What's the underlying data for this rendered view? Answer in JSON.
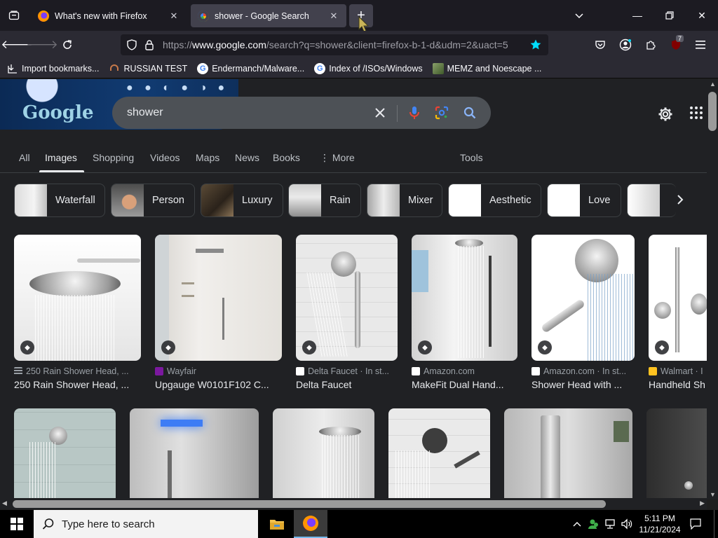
{
  "browser": {
    "tabs": [
      {
        "title": "What's new with Firefox",
        "active": false
      },
      {
        "title": "shower - Google Search",
        "active": true
      }
    ],
    "new_tab": "+",
    "url_prefix": "https://",
    "url_host": "www.google.com",
    "url_path": "/search?q=shower&client=firefox-b-1-d&udm=2&uact=5",
    "extension_badge": "7",
    "bookmarks": [
      {
        "label": "Import bookmarks...",
        "icon": "import-icon"
      },
      {
        "label": "RUSSIAN TEST",
        "icon": "headphones-icon"
      },
      {
        "label": "Endermanch/Malware...",
        "icon": "google-icon"
      },
      {
        "label": "Index of /ISOs/Windows",
        "icon": "google-icon"
      },
      {
        "label": "MEMZ and Noescape ...",
        "icon": "image-icon"
      }
    ]
  },
  "google": {
    "logo": "Google",
    "query": "shower",
    "filters": [
      "All",
      "Images",
      "Shopping",
      "Videos",
      "Maps",
      "News",
      "Books",
      "More",
      "Tools"
    ],
    "active_filter": "Images",
    "chips": [
      "Waterfall",
      "Person",
      "Luxury",
      "Rain",
      "Mixer",
      "Aesthetic",
      "Love"
    ],
    "results": [
      {
        "source": "250 Rain Shower Head, ...",
        "caption": "250 Rain Shower Head, ..."
      },
      {
        "source": "Wayfair",
        "caption": "Upgauge W0101F102 C..."
      },
      {
        "source": "Delta Faucet · In st...",
        "caption": "Delta Faucet"
      },
      {
        "source": "Amazon.com",
        "caption": "MakeFit Dual Hand..."
      },
      {
        "source": "Amazon.com · In st...",
        "caption": "Shower Head with ..."
      },
      {
        "source": "Walmart · I",
        "caption": "Handheld Sh"
      }
    ]
  },
  "taskbar": {
    "search_placeholder": "Type here to search",
    "time": "5:11 PM",
    "date": "11/21/2024"
  },
  "colors": {
    "page_bg": "#202124",
    "chrome_bg": "#2b2a33",
    "tab_active": "#42414d",
    "bookmark_star": "#00ddff"
  }
}
